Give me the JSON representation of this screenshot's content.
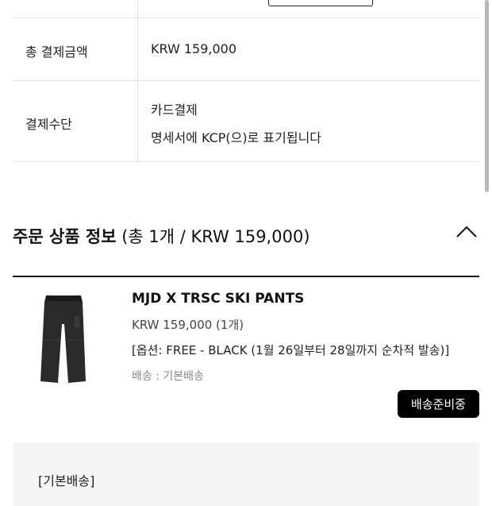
{
  "payment": {
    "total_label": "총 결제금액",
    "total_value": "KRW 159,000",
    "method_label": "결제수단",
    "method_value": "카드결제",
    "method_note": "명세서에 KCP(으)로 표기됩니다"
  },
  "order_section": {
    "title": "주문 상품 정보",
    "summary": "(총 1개 / KRW 159,000)",
    "collapse_icon": "chevron-up-icon"
  },
  "product": {
    "name": "MJD X TRSC SKI PANTS",
    "price": "KRW 159,000 (1개)",
    "option": "[옵션: FREE - BLACK (1월 26일부터 28일까지 순차적 발송)]",
    "shipping": "배송 : 기본배송",
    "status": "배송준비중"
  },
  "shipping_box": {
    "title": "[기본배송]"
  },
  "colors": {
    "badge_bg": "#000000",
    "divider": "#e2e2e2"
  }
}
